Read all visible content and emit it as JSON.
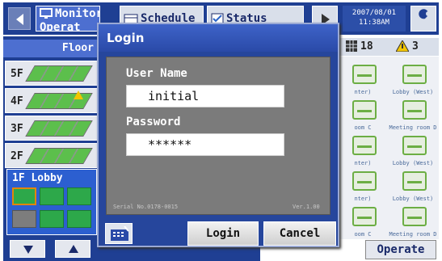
{
  "top_bar": {
    "tabs": [
      {
        "label_line1": "Monitor/",
        "label_line2": "Operat",
        "icon": "monitor-icon"
      },
      {
        "label": "Schedule",
        "icon": "calendar-icon"
      },
      {
        "label": "Status",
        "icon": "checklist-icon"
      }
    ],
    "date": "2007/08/01",
    "time": "11:38AM"
  },
  "counters": {
    "grid_count": "18",
    "warning_count": "3"
  },
  "floor_panel": {
    "tab_label": "Floor",
    "floors": [
      {
        "label": "5F",
        "warning": false
      },
      {
        "label": "4F",
        "warning": true
      },
      {
        "label": "3F",
        "warning": false
      },
      {
        "label": "2F",
        "warning": false
      }
    ],
    "selected_floor": "1F Lobby"
  },
  "rooms": [
    {
      "name": "nter)"
    },
    {
      "name": "Lobby (West)"
    },
    {
      "name": "oom C"
    },
    {
      "name": "Meeting room D"
    },
    {
      "name": "nter)"
    },
    {
      "name": "Lobby (West)"
    },
    {
      "name": "nter)"
    },
    {
      "name": "Lobby (West)"
    },
    {
      "name": "oom C"
    },
    {
      "name": "Meeting room D"
    }
  ],
  "operate_label": "Operate",
  "login_dialog": {
    "title": "Login",
    "username_label": "User Name",
    "username_value": "initial",
    "password_label": "Password",
    "password_value": "******",
    "serial": "Serial No.0178-0015",
    "version": "Ver.1.00",
    "login_label": "Login",
    "cancel_label": "Cancel"
  },
  "colors": {
    "accent": "#1f3f93",
    "tab_active": "#4d6fd0",
    "unit_on": "#2da84a",
    "warning": "#f2c500"
  }
}
